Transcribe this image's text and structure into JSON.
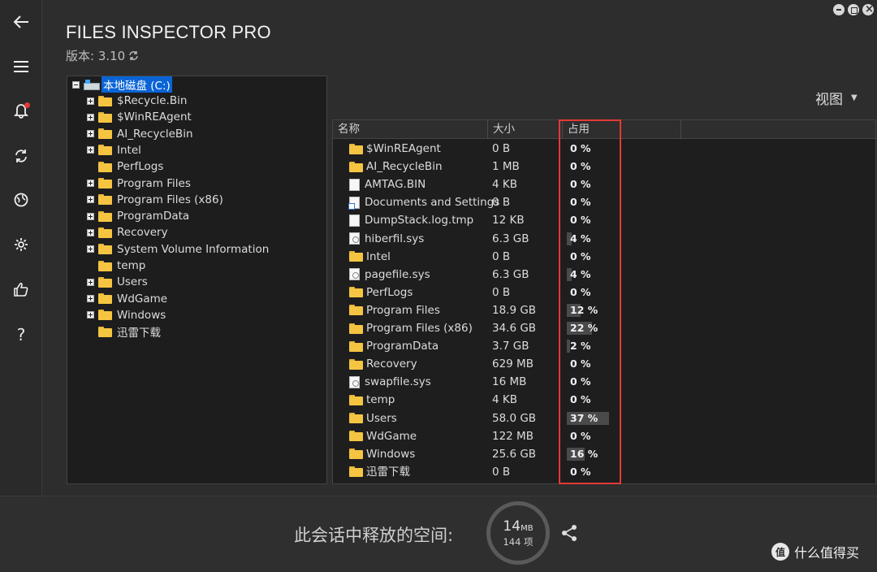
{
  "app": {
    "title": "FILES INSPECTOR PRO",
    "version_label": "版本: 3.10"
  },
  "rail": {
    "icons": [
      "back-arrow-icon",
      "menu-icon",
      "bell-icon",
      "refresh-icon",
      "globe-icon",
      "gear-icon",
      "thumbs-up-icon",
      "help-icon"
    ]
  },
  "view": {
    "label": "视图"
  },
  "tree": {
    "root_label": "本地磁盘 (C:)",
    "children": [
      {
        "label": "$Recycle.Bin",
        "expandable": true
      },
      {
        "label": "$WinREAgent",
        "expandable": true
      },
      {
        "label": "AI_RecycleBin",
        "expandable": true
      },
      {
        "label": "Intel",
        "expandable": true
      },
      {
        "label": "PerfLogs",
        "expandable": false
      },
      {
        "label": "Program Files",
        "expandable": true
      },
      {
        "label": "Program Files (x86)",
        "expandable": true
      },
      {
        "label": "ProgramData",
        "expandable": true
      },
      {
        "label": "Recovery",
        "expandable": true
      },
      {
        "label": "System Volume Information",
        "expandable": true
      },
      {
        "label": "temp",
        "expandable": false
      },
      {
        "label": "Users",
        "expandable": true
      },
      {
        "label": "WdGame",
        "expandable": true
      },
      {
        "label": "Windows",
        "expandable": true
      },
      {
        "label": "迅雷下载",
        "expandable": false
      }
    ]
  },
  "list": {
    "columns": {
      "name": "名称",
      "size": "大小",
      "usage": "占用"
    },
    "rows": [
      {
        "name": "$WinREAgent",
        "size": "0 B",
        "pct": 0,
        "pct_label": "0 %",
        "icon": "folder"
      },
      {
        "name": "AI_RecycleBin",
        "size": "1 MB",
        "pct": 0,
        "pct_label": "0 %",
        "icon": "folder"
      },
      {
        "name": "AMTAG.BIN",
        "size": "4 KB",
        "pct": 0,
        "pct_label": "0 %",
        "icon": "file"
      },
      {
        "name": "Documents and Settings",
        "size": "0 B",
        "pct": 0,
        "pct_label": "0 %",
        "icon": "link"
      },
      {
        "name": "DumpStack.log.tmp",
        "size": "12 KB",
        "pct": 0,
        "pct_label": "0 %",
        "icon": "file"
      },
      {
        "name": "hiberfil.sys",
        "size": "6.3 GB",
        "pct": 4,
        "pct_label": "4 %",
        "icon": "sys"
      },
      {
        "name": "Intel",
        "size": "0 B",
        "pct": 0,
        "pct_label": "0 %",
        "icon": "folder"
      },
      {
        "name": "pagefile.sys",
        "size": "6.3 GB",
        "pct": 4,
        "pct_label": "4 %",
        "icon": "sys"
      },
      {
        "name": "PerfLogs",
        "size": "0 B",
        "pct": 0,
        "pct_label": "0 %",
        "icon": "folder"
      },
      {
        "name": "Program Files",
        "size": "18.9 GB",
        "pct": 12,
        "pct_label": "12 %",
        "icon": "folder"
      },
      {
        "name": "Program Files (x86)",
        "size": "34.6 GB",
        "pct": 22,
        "pct_label": "22 %",
        "icon": "folder"
      },
      {
        "name": "ProgramData",
        "size": "3.7 GB",
        "pct": 2,
        "pct_label": "2 %",
        "icon": "folder"
      },
      {
        "name": "Recovery",
        "size": "629 MB",
        "pct": 0,
        "pct_label": "0 %",
        "icon": "folder"
      },
      {
        "name": "swapfile.sys",
        "size": "16 MB",
        "pct": 0,
        "pct_label": "0 %",
        "icon": "sys"
      },
      {
        "name": "temp",
        "size": "4 KB",
        "pct": 0,
        "pct_label": "0 %",
        "icon": "folder"
      },
      {
        "name": "Users",
        "size": "58.0 GB",
        "pct": 37,
        "pct_label": "37 %",
        "icon": "folder"
      },
      {
        "name": "WdGame",
        "size": "122 MB",
        "pct": 0,
        "pct_label": "0 %",
        "icon": "folder"
      },
      {
        "name": "Windows",
        "size": "25.6 GB",
        "pct": 16,
        "pct_label": "16 %",
        "icon": "folder"
      },
      {
        "name": "迅雷下载",
        "size": "0 B",
        "pct": 0,
        "pct_label": "0 %",
        "icon": "folder"
      }
    ]
  },
  "footer": {
    "freed_label": "此会话中释放的空间:",
    "freed_amount": "14",
    "freed_unit": "MB",
    "freed_items": "144 项"
  },
  "watermark": {
    "logo_text": "值",
    "text": "什么值得买"
  },
  "colors": {
    "highlight": "#e53935",
    "selection": "#0a64d6",
    "folder": "#f5c542"
  }
}
